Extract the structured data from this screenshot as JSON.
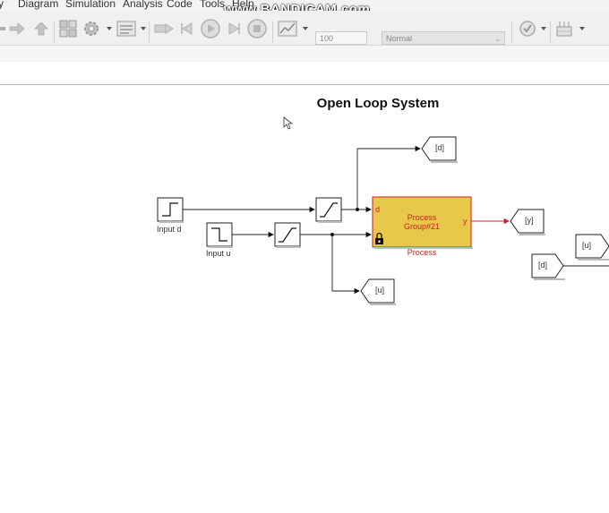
{
  "menu": [
    "y",
    "Diagram",
    "Simulation",
    "Analysis",
    "Code",
    "Tools",
    "Help"
  ],
  "watermark": "www.BANDICAM.com",
  "toolbar": {
    "stop_time": "100",
    "sim_mode": "Normal"
  },
  "model": {
    "title": "Open Loop System",
    "blocks": {
      "input_d": "Input d",
      "input_u": "Input u",
      "process_line1": "Process",
      "process_line2": "Group#21",
      "process_port_d": "d",
      "process_port_y": "y",
      "process_name": "Process",
      "goto_d": "[d]",
      "goto_y": "[y]",
      "goto_u": "[u]",
      "from_u": "[u]",
      "from_d": "[d]"
    }
  },
  "colors": {
    "process_fill": "#e8c84a",
    "process_border": "#d43c3c",
    "process_text": "#cc2222",
    "signal_red": "#cc2222"
  }
}
